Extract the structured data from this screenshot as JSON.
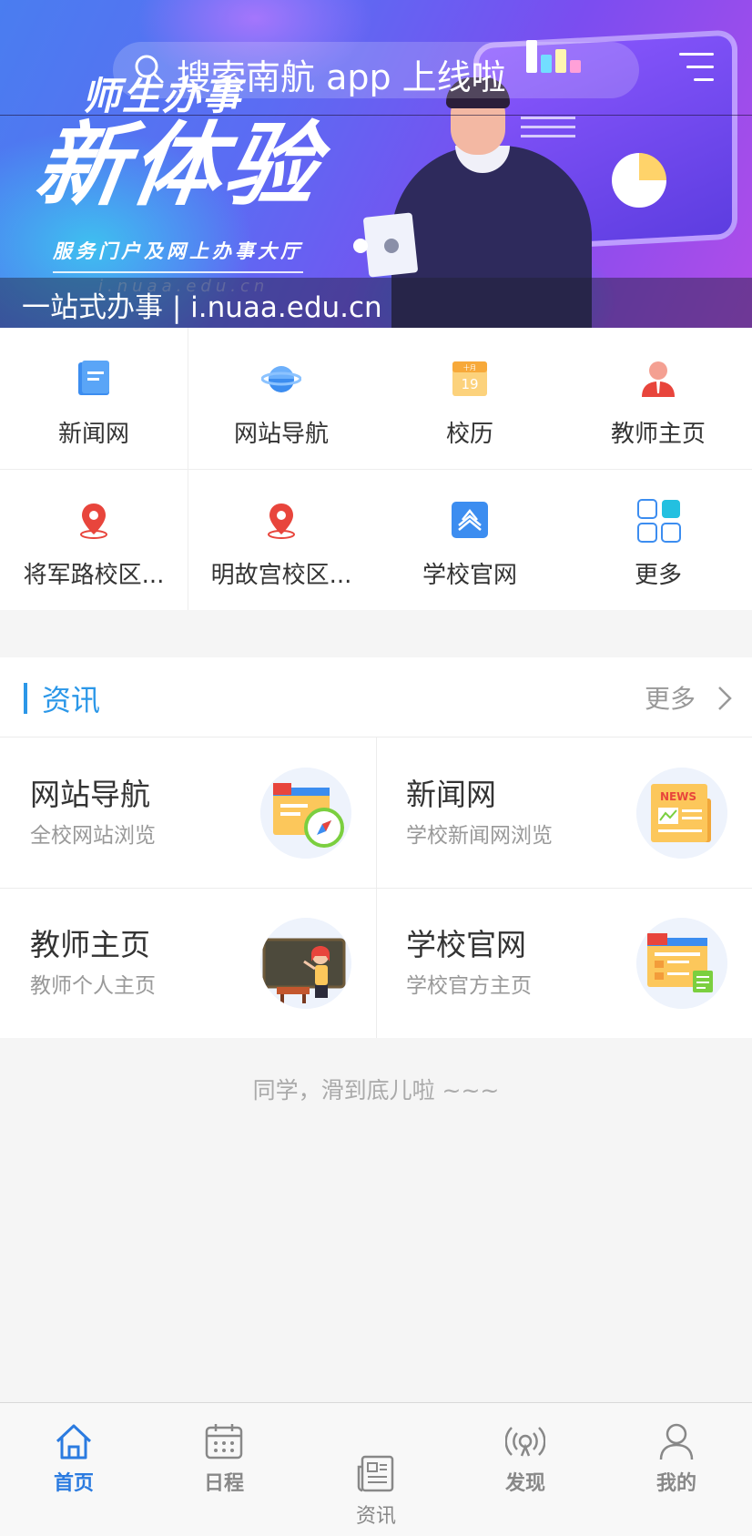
{
  "banner": {
    "search_placeholder": "搜索南航 app 上线啦",
    "title_small": "师生办事",
    "title_big": "新体验",
    "tagline": "服务门户及网上办事大厅",
    "watermark": "i.nuaa.edu.cn",
    "caption": "一站式办事 | i.nuaa.edu.cn"
  },
  "quick_links": [
    {
      "label": "新闻网",
      "icon": "news-doc-icon"
    },
    {
      "label": "网站导航",
      "icon": "planet-icon"
    },
    {
      "label": "校历",
      "icon": "calendar-icon"
    },
    {
      "label": "教师主页",
      "icon": "teacher-icon"
    },
    {
      "label": "将军路校区...",
      "icon": "location-pin-icon"
    },
    {
      "label": "明故宫校区...",
      "icon": "location-pin-icon"
    },
    {
      "label": "学校官网",
      "icon": "school-logo-icon"
    },
    {
      "label": "更多",
      "icon": "grid-more-icon"
    }
  ],
  "info": {
    "title": "资讯",
    "more": "更多",
    "cards": [
      {
        "title": "网站导航",
        "subtitle": "全校网站浏览"
      },
      {
        "title": "新闻网",
        "subtitle": "学校新闻网浏览",
        "badge": "NEWS"
      },
      {
        "title": "教师主页",
        "subtitle": "教师个人主页"
      },
      {
        "title": "学校官网",
        "subtitle": "学校官方主页"
      }
    ]
  },
  "end_note": "同学，滑到底儿啦 ~~~",
  "tabbar": {
    "items": [
      {
        "label": "首页",
        "active": true
      },
      {
        "label": "日程",
        "active": false
      },
      {
        "label": "资讯",
        "active": false
      },
      {
        "label": "发现",
        "active": false
      },
      {
        "label": "我的",
        "active": false
      }
    ]
  },
  "colors": {
    "accent": "#2b97e8",
    "tab_active": "#2b7be0",
    "tab_inactive": "#888888",
    "pin_red": "#e8453c"
  }
}
